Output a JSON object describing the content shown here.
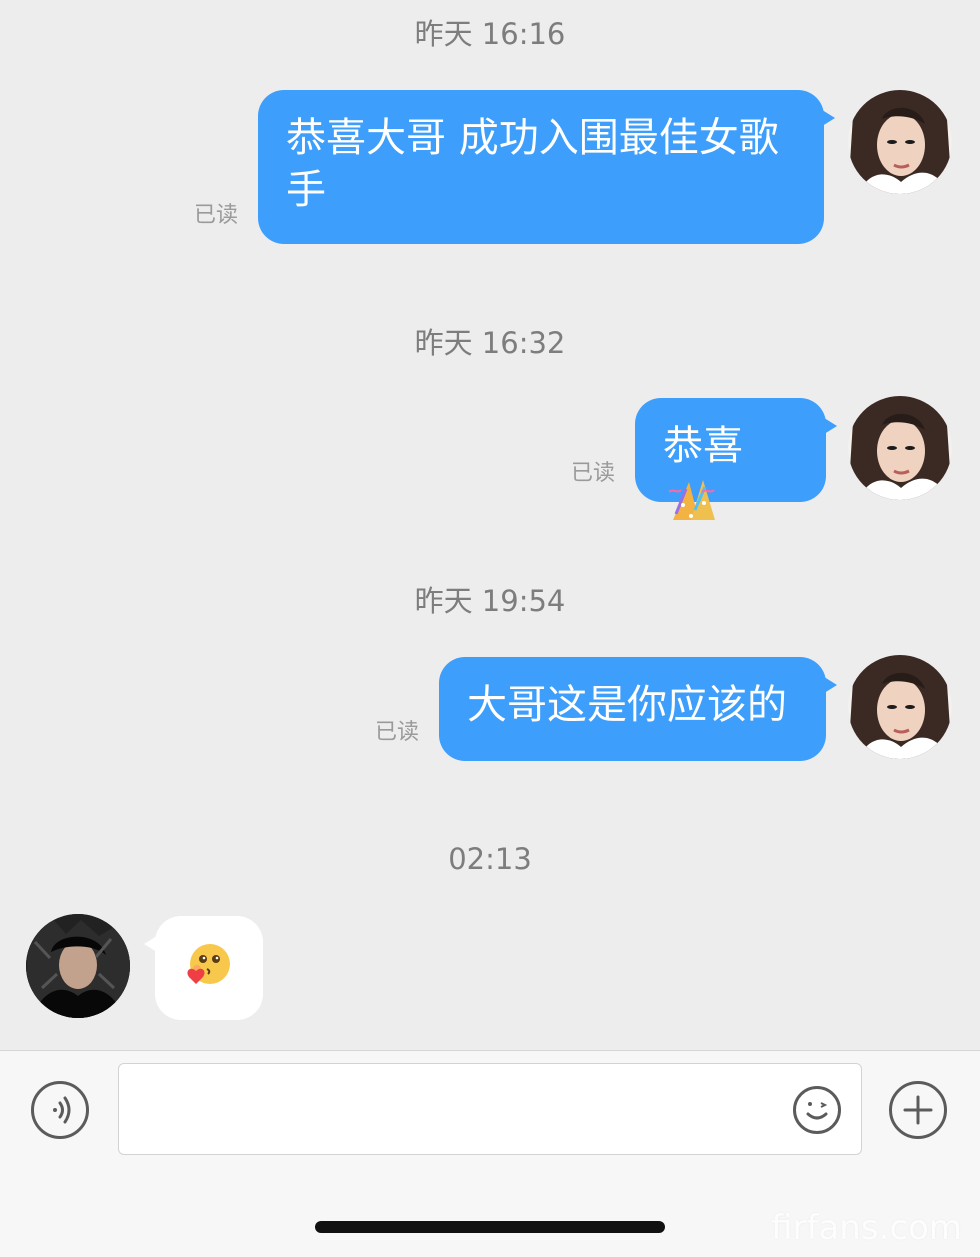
{
  "messages": [
    {
      "time": "昨天 16:16",
      "sender": "me",
      "text_line1": "恭喜大哥 成功入围最佳女歌",
      "text_line2": "手",
      "read": "已读"
    },
    {
      "time": "昨天 16:32",
      "sender": "me",
      "text": "恭喜",
      "emoji": "party-popper-icon",
      "read": "已读"
    },
    {
      "time": "昨天 19:54",
      "sender": "me",
      "text": "大哥这是你应该的",
      "read": "已读"
    },
    {
      "time": "02:13",
      "sender": "other",
      "emoji": "blowing-kiss-heart-icon"
    }
  ],
  "composer": {
    "voice_icon": "voice-icon",
    "emoji_icon": "smile-icon",
    "plus_icon": "plus-icon",
    "input_value": ""
  },
  "watermark": "firfans.com",
  "colors": {
    "background": "#ededed",
    "outgoing_bubble": "#3d9efb",
    "incoming_bubble": "#ffffff",
    "composer": "#f7f7f7"
  }
}
